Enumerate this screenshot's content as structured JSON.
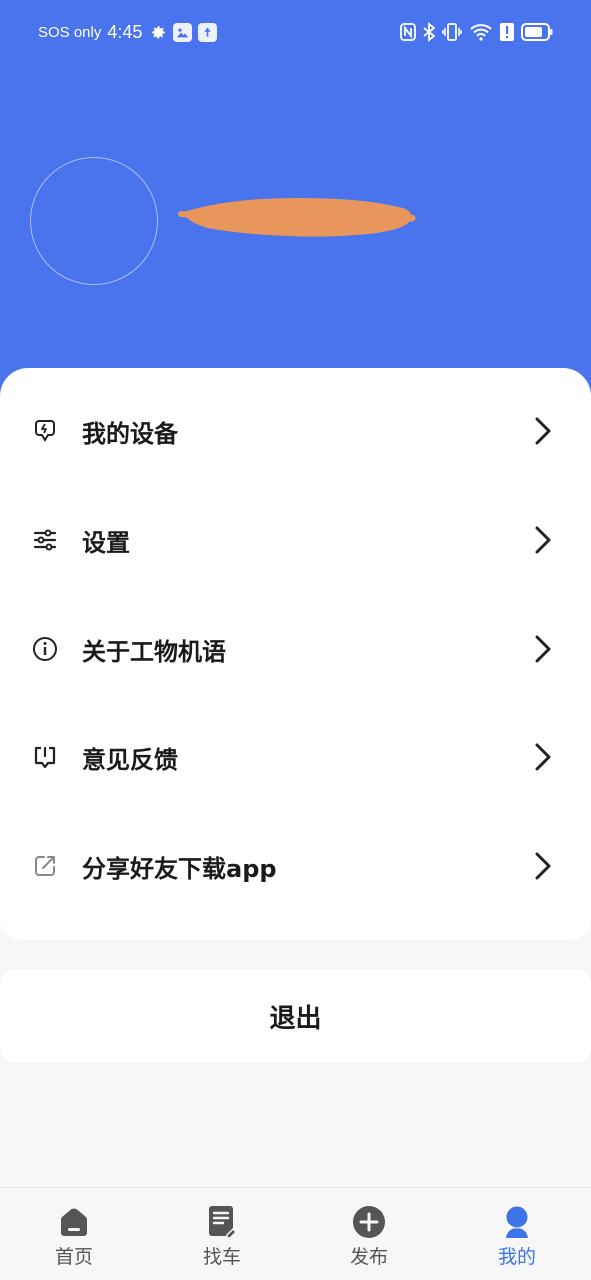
{
  "status_bar": {
    "carrier": "SOS only",
    "time": "4:45",
    "icons": [
      "gear-icon",
      "photo-icon",
      "upload-icon",
      "nfc-icon",
      "bluetooth-icon",
      "vibrate-icon",
      "wifi-icon",
      "alert-icon",
      "battery-icon"
    ]
  },
  "profile": {
    "avatar": "avatar-circle",
    "name_redacted": true
  },
  "menu": {
    "items": [
      {
        "label": "我的设备",
        "icon": "device-icon"
      },
      {
        "label": "设置",
        "icon": "sliders-icon"
      },
      {
        "label": "关于工物机语",
        "icon": "info-icon"
      },
      {
        "label": "意见反馈",
        "icon": "feedback-icon"
      },
      {
        "label": "分享好友下载app",
        "icon": "share-icon"
      }
    ]
  },
  "logout": {
    "label": "退出"
  },
  "tabbar": {
    "tabs": [
      {
        "label": "首页",
        "icon": "home-icon",
        "active": false
      },
      {
        "label": "找车",
        "icon": "document-icon",
        "active": false
      },
      {
        "label": "发布",
        "icon": "plus-circle-icon",
        "active": false
      },
      {
        "label": "我的",
        "icon": "person-icon",
        "active": true
      }
    ]
  },
  "colors": {
    "header": "#4a73ee",
    "accent": "#3d74e8",
    "redaction": "#e8965c"
  }
}
